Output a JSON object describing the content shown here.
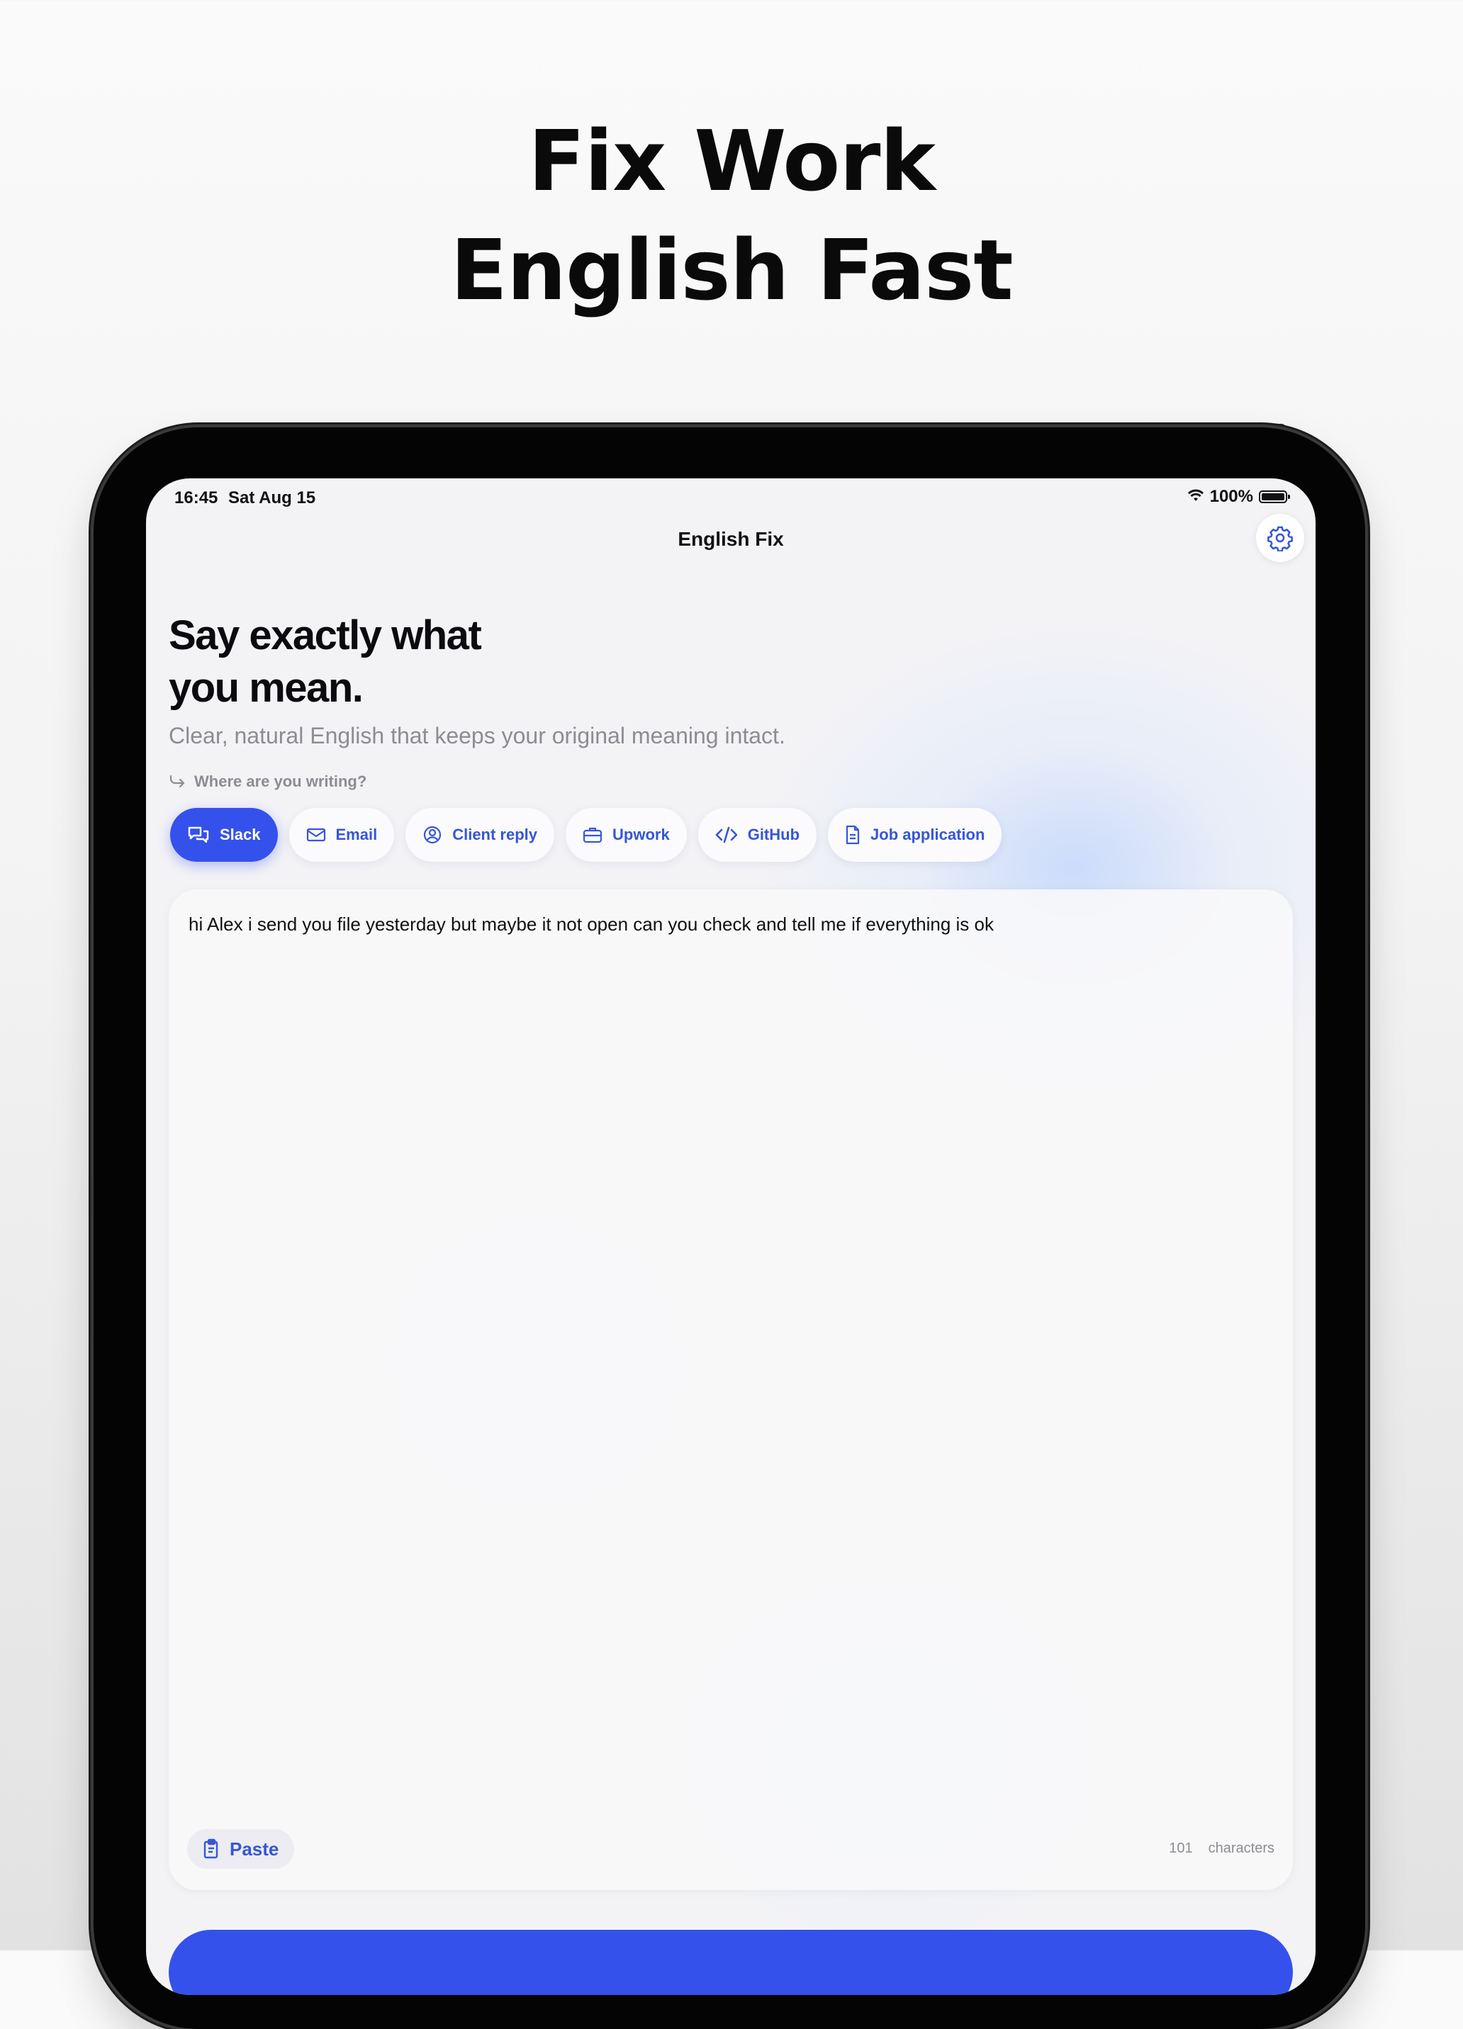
{
  "headline": {
    "line1": "Fix Work",
    "line2": "English Fast"
  },
  "status_bar": {
    "time": "16:45",
    "date": "Sat Aug 15",
    "battery": "100%"
  },
  "nav": {
    "title": "English Fix",
    "settings_icon": "gear-icon"
  },
  "hero": {
    "title_line1": "Say exactly what",
    "title_line2": "you mean.",
    "subtitle": "Clear, natural English that keeps your original meaning intact."
  },
  "context_prompt": "Where are you writing?",
  "contexts": [
    {
      "label": "Slack",
      "icon": "chat-bubbles-icon",
      "selected": true
    },
    {
      "label": "Email",
      "icon": "envelope-icon",
      "selected": false
    },
    {
      "label": "Client reply",
      "icon": "person-chat-icon",
      "selected": false
    },
    {
      "label": "Upwork",
      "icon": "briefcase-icon",
      "selected": false
    },
    {
      "label": "GitHub",
      "icon": "code-icon",
      "selected": false
    },
    {
      "label": "Job application",
      "icon": "document-icon",
      "selected": false
    }
  ],
  "editor": {
    "text": "hi Alex i send you file yesterday but maybe it not open can you check and tell me if everything is ok",
    "paste_label": "Paste",
    "char_count": "101",
    "char_label": "characters"
  },
  "colors": {
    "accent": "#3451ec",
    "chip_text": "#3656d6",
    "muted": "#8c8c93"
  }
}
